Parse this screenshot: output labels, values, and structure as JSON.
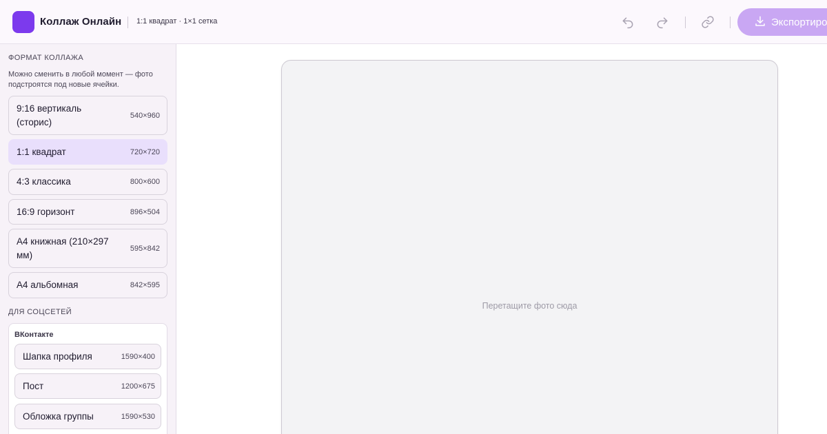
{
  "header": {
    "app_title": "Коллаж Онлайн",
    "subtitle": "1:1 квадрат · 1×1 сетка",
    "export_label": "Экспортировать",
    "icons": [
      "undo-icon",
      "redo-icon",
      "link-icon",
      "download-icon"
    ]
  },
  "colors": {
    "accent": "#7c3aed",
    "export_button": "#c9a7f3",
    "selected_item": "#e9dffc"
  },
  "sidebar": {
    "format_title": "ФОРМАТ КОЛЛАЖА",
    "help_text": "Можно сменить в любой момент — фото подстроятся под новые ячейки.",
    "formats": [
      {
        "label": "9:16 вертикаль (сторис)",
        "size": "540×960",
        "selected": false
      },
      {
        "label": "1:1 квадрат",
        "size": "720×720",
        "selected": true
      },
      {
        "label": "4:3 классика",
        "size": "800×600",
        "selected": false
      },
      {
        "label": "16:9 горизонт",
        "size": "896×504",
        "selected": false
      },
      {
        "label": "A4 книжная (210×297 мм)",
        "size": "595×842",
        "selected": false
      },
      {
        "label": "A4 альбомная",
        "size": "842×595",
        "selected": false
      }
    ],
    "social_title": "ДЛЯ СОЦСЕТЕЙ",
    "social_groups": [
      {
        "name": "ВКонтакте",
        "items": [
          {
            "label": "Шапка профиля",
            "size": "1590×400"
          },
          {
            "label": "Пост",
            "size": "1200×675"
          },
          {
            "label": "Обложка группы",
            "size": "1590×530"
          }
        ]
      }
    ]
  },
  "canvas": {
    "drop_hint": "Перетащите фото сюда"
  }
}
